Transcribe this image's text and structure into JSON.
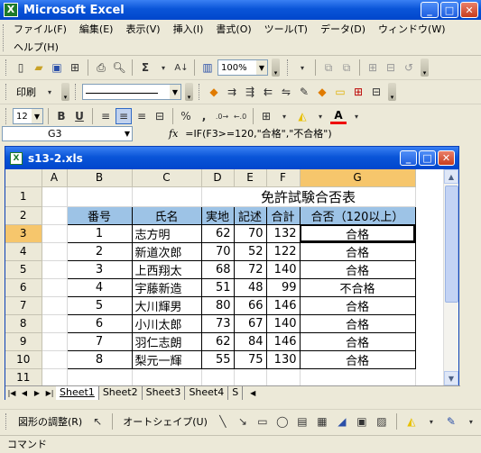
{
  "app": {
    "title": "Microsoft Excel",
    "icon_letter": "X",
    "window_buttons": [
      "_",
      "□",
      "✕"
    ]
  },
  "menu": {
    "row1": [
      "ファイル(F)",
      "編集(E)",
      "表示(V)",
      "挿入(I)",
      "書式(O)",
      "ツール(T)",
      "データ(D)",
      "ウィンドウ(W)"
    ],
    "row2": [
      "ヘルプ(H)"
    ]
  },
  "toolbar1": {
    "zoom": "100%"
  },
  "toolbar2": {
    "print_label": "印刷"
  },
  "toolbar3": {
    "font_size": "12",
    "bold": "B",
    "underline": "U",
    "percent": "%",
    "comma": ",",
    "font_color": "A"
  },
  "formula_bar": {
    "cell_ref": "G3",
    "fx": "fx",
    "formula": "=IF(F3>=120,\"合格\",\"不合格\")"
  },
  "workbook": {
    "filename": "s13-2.xls",
    "columns": [
      "A",
      "B",
      "C",
      "D",
      "E",
      "F",
      "G"
    ],
    "selected_column": "G",
    "selected_row": "3",
    "title_row": "免許試験合否表",
    "headers": [
      "番号",
      "氏名",
      "実地",
      "記述",
      "合計",
      "合否（120以上）"
    ],
    "rows": [
      {
        "row": "3",
        "no": "1",
        "name": "志方明",
        "jitchi": "62",
        "kijutsu": "70",
        "total": "132",
        "result": "合格"
      },
      {
        "row": "4",
        "no": "2",
        "name": "新道次郎",
        "jitchi": "70",
        "kijutsu": "52",
        "total": "122",
        "result": "合格"
      },
      {
        "row": "5",
        "no": "3",
        "name": "上西翔太",
        "jitchi": "68",
        "kijutsu": "72",
        "total": "140",
        "result": "合格"
      },
      {
        "row": "6",
        "no": "4",
        "name": "宇藤新造",
        "jitchi": "51",
        "kijutsu": "48",
        "total": "99",
        "result": "不合格"
      },
      {
        "row": "7",
        "no": "5",
        "name": "大川輝男",
        "jitchi": "80",
        "kijutsu": "66",
        "total": "146",
        "result": "合格"
      },
      {
        "row": "8",
        "no": "6",
        "name": "小川太郎",
        "jitchi": "73",
        "kijutsu": "67",
        "total": "140",
        "result": "合格"
      },
      {
        "row": "9",
        "no": "7",
        "name": "羽仁志朗",
        "jitchi": "62",
        "kijutsu": "84",
        "total": "146",
        "result": "合格"
      },
      {
        "row": "10",
        "no": "8",
        "name": "梨元一輝",
        "jitchi": "55",
        "kijutsu": "75",
        "total": "130",
        "result": "合格"
      }
    ],
    "row_numbers": [
      "1",
      "2",
      "11"
    ],
    "sheet_tabs": [
      "Sheet1",
      "Sheet2",
      "Sheet3",
      "Sheet4",
      "S"
    ],
    "active_sheet": "Sheet1"
  },
  "drawbar": {
    "adjust_label": "図形の調整(R)",
    "autoshape_label": "オートシェイプ(U)"
  },
  "status": {
    "text": "コマンド"
  }
}
